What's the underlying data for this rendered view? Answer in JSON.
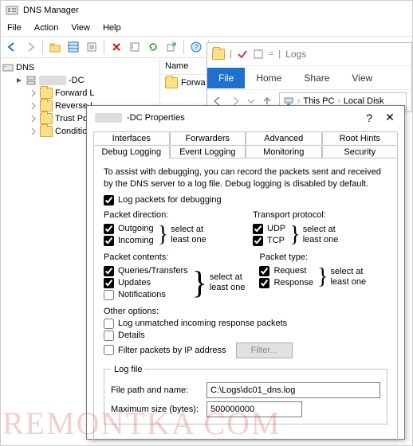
{
  "app": {
    "title": "DNS Manager"
  },
  "menu": {
    "file": "File",
    "action": "Action",
    "view": "View",
    "help": "Help"
  },
  "tree": {
    "root": "DNS",
    "server_masked": "-DC",
    "items": [
      "Forward L",
      "Reverse L",
      "Trust Poi",
      "Conditio"
    ]
  },
  "list": {
    "header": "Name",
    "row1": "Forwa"
  },
  "explorer": {
    "crumb": "Logs",
    "tabs": {
      "file": "File",
      "home": "Home",
      "share": "Share",
      "view": "View"
    },
    "path": {
      "thispc": "This PC",
      "localdisk": "Local Disk"
    }
  },
  "props": {
    "title_suffix": "-DC       Properties",
    "help": "?",
    "close": "✕",
    "tabs_row1": [
      "Interfaces",
      "Forwarders",
      "Advanced",
      "Root Hints"
    ],
    "tabs_row2": [
      "Debug Logging",
      "Event Logging",
      "Monitoring",
      "Security"
    ],
    "desc": "To assist with debugging, you can record the packets sent and received by the DNS server to a log file. Debug logging is disabled by default.",
    "log_packets": "Log packets for debugging",
    "direction": {
      "label": "Packet direction:",
      "outgoing": "Outgoing",
      "incoming": "Incoming"
    },
    "transport": {
      "label": "Transport protocol:",
      "udp": "UDP",
      "tcp": "TCP"
    },
    "contents": {
      "label": "Packet contents:",
      "queries": "Queries/Transfers",
      "updates": "Updates",
      "notifications": "Notifications"
    },
    "ptype": {
      "label": "Packet type:",
      "request": "Request",
      "response": "Response"
    },
    "select_at_least_one": "select at\nleast one",
    "other": {
      "label": "Other options:",
      "unmatched": "Log unmatched incoming response packets",
      "details": "Details",
      "filterip": "Filter packets by IP address",
      "filter_btn": "Filter..."
    },
    "logfile": {
      "legend": "Log file",
      "path_label": "File path and name:",
      "path_value": "C:\\Logs\\dc01_dns.log",
      "max_label": "Maximum size (bytes):",
      "max_value": "500000000"
    }
  },
  "wm": "REMONTKA           COM"
}
